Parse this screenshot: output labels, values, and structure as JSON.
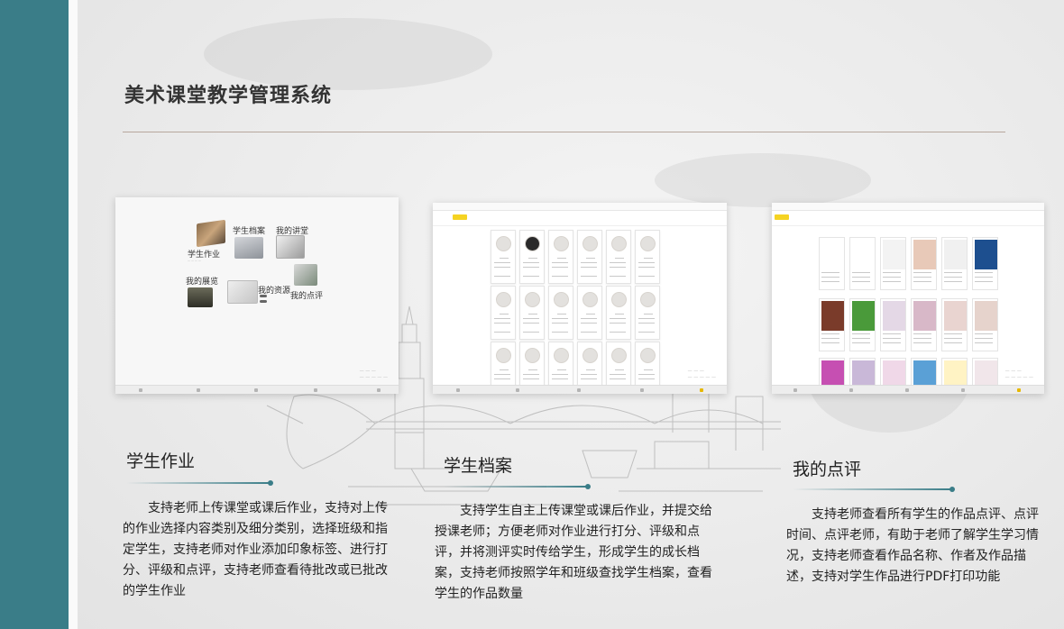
{
  "page_title": "美术课堂教学管理系统",
  "colors": {
    "side_bar": "#3a7d88",
    "accent": "#3a7d88",
    "rule": "#b7a79d",
    "tab_active": "#f5d322"
  },
  "screens": [
    {
      "id": "home",
      "tiles": [
        {
          "label": "学生作业",
          "icon": "student-homework-icon"
        },
        {
          "label": "学生档案",
          "icon": "student-archive-icon"
        },
        {
          "label": "我的讲堂",
          "icon": "my-lecture-icon"
        },
        {
          "label": "我的展览",
          "icon": "my-exhibition-icon"
        },
        {
          "label": "我的资源",
          "icon": "my-resources-icon"
        },
        {
          "label": "我的点评",
          "icon": "my-review-icon"
        }
      ]
    },
    {
      "id": "student-archive-grid",
      "active_tab": "学生档案"
    },
    {
      "id": "review-grid",
      "active_tab": "我的点评"
    }
  ],
  "sections": [
    {
      "title": "学生作业",
      "description": "支持老师上传课堂或课后作业，支持对上传的作业选择内容类别及细分类别，选择班级和指定学生，支持老师对作业添加印象标签、进行打分、评级和点评，支持老师查看待批改或已批改的学生作业"
    },
    {
      "title": "学生档案",
      "description": "支持学生自主上传课堂或课后作业，并提交给授课老师；方便老师对作业进行打分、评级和点评，并将测评实时传给学生，形成学生的成长档案，支持老师按照学年和班级查找学生档案，查看学生的作品数量"
    },
    {
      "title": "我的点评",
      "description": "支持老师查看所有学生的作品点评、点评时间、点评老师，有助于老师了解学生学习情况，支持老师查看作品名称、作者及作品描述，支持对学生作品进行PDF打印功能"
    }
  ]
}
